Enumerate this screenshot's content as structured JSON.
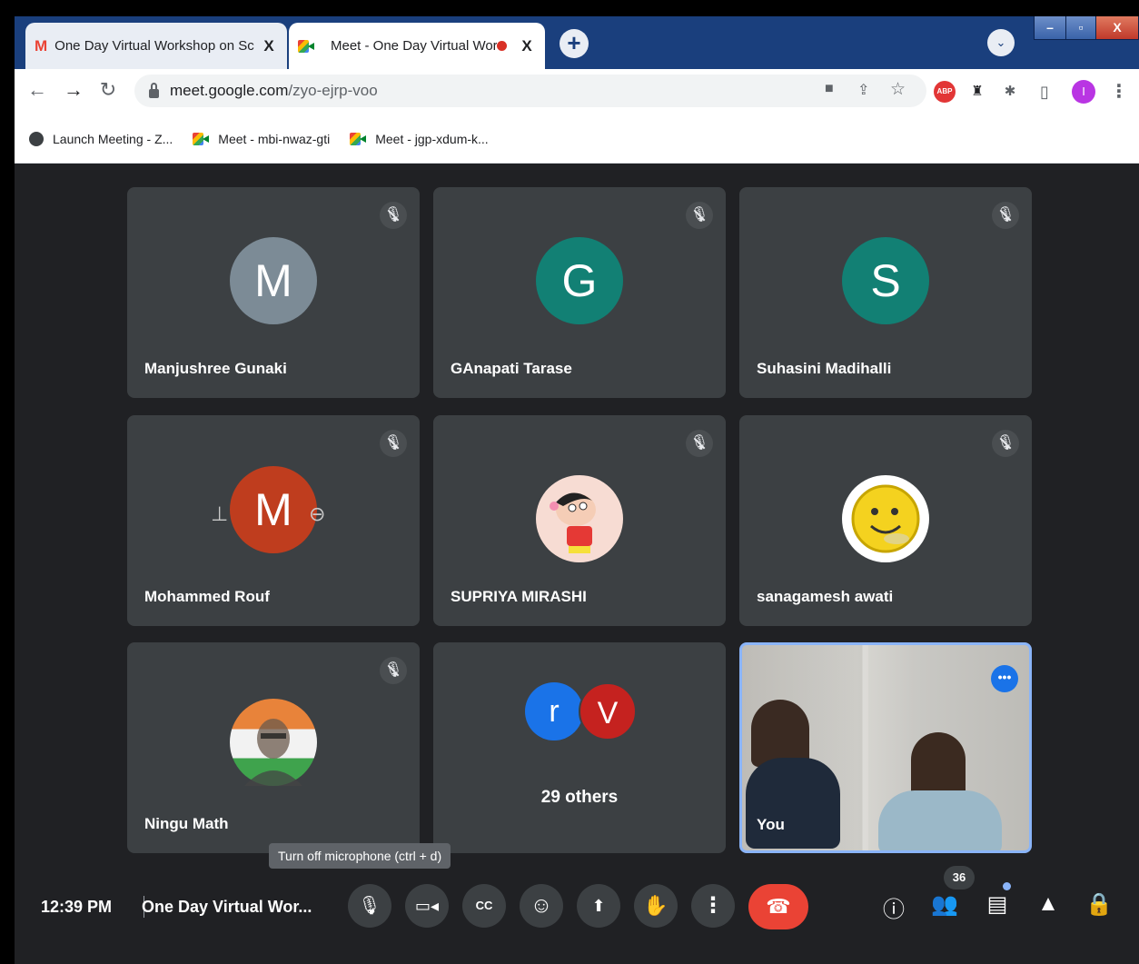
{
  "browser": {
    "tabs": [
      {
        "title": "One Day Virtual Workshop on Sc",
        "close": "X"
      },
      {
        "title": "Meet - One Day Virtual Worl",
        "close": "X"
      }
    ],
    "new_tab": "+",
    "tab_search": "⌄",
    "window": {
      "minimize": "–",
      "maximize": "▫",
      "close": "X"
    },
    "url_host": "meet.google.com",
    "url_path": "/zyo-ejrp-voo",
    "extensions": {
      "abp": "ABP"
    },
    "profile_initial": "I"
  },
  "bookmarks": [
    {
      "label": "Launch Meeting - Z..."
    },
    {
      "label": "Meet - mbi-nwaz-gti"
    },
    {
      "label": "Meet - jgp-xdum-k..."
    }
  ],
  "participants": [
    {
      "name": "Manjushree Gunaki",
      "initial": "M",
      "color": "#7c8b96"
    },
    {
      "name": "GAnapati Tarase",
      "initial": "G",
      "color": "#128074"
    },
    {
      "name": "Suhasini Madihalli",
      "initial": "S",
      "color": "#128074"
    },
    {
      "name": "Mohammed Rouf",
      "initial": "M",
      "color": "#bf3d1e"
    },
    {
      "name": "SUPRIYA MIRASHI"
    },
    {
      "name": "sanagamesh awati"
    },
    {
      "name": "Ningu Math"
    }
  ],
  "others": {
    "initials": [
      "r",
      "V"
    ],
    "label": "29 others",
    "colors": [
      "#1a73e8",
      "#c5221f"
    ]
  },
  "self": {
    "label": "You"
  },
  "tooltip": "Turn off microphone (ctrl + d)",
  "meeting": {
    "time": "12:39 PM",
    "title": "One Day Virtual Wor...",
    "participant_count": "36"
  }
}
